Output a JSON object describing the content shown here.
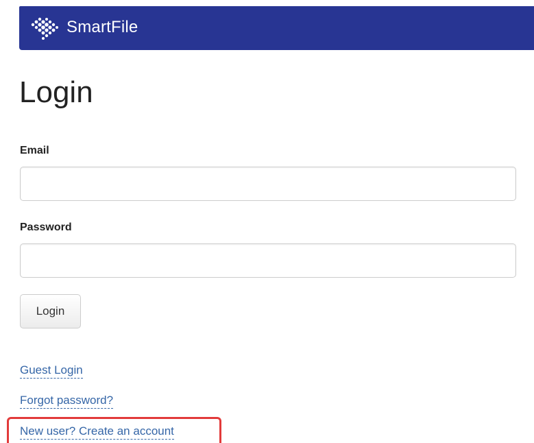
{
  "header": {
    "brand": "SmartFile",
    "logo_icon": "smartfile-dots-logo-icon"
  },
  "colors": {
    "header_bg": "#283593",
    "link": "#3566a7",
    "highlight": "#e23a3a"
  },
  "login_form": {
    "title": "Login",
    "email_label": "Email",
    "email_value": "",
    "password_label": "Password",
    "password_value": "",
    "submit_label": "Login"
  },
  "links": {
    "guest_login": "Guest Login",
    "forgot_password": "Forgot password?",
    "create_account": "New user? Create an account"
  }
}
